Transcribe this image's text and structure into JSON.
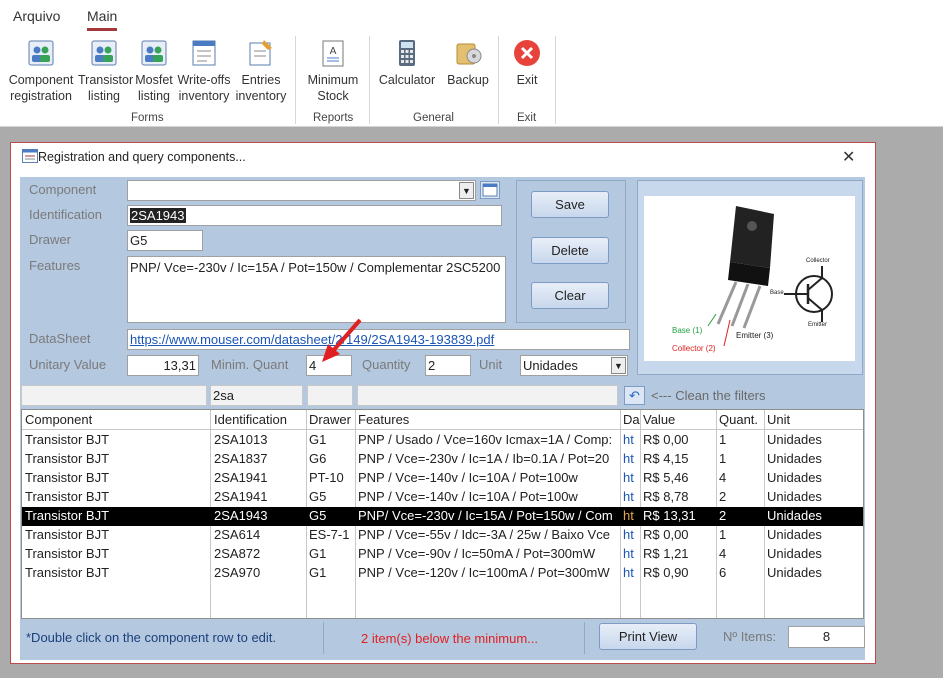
{
  "ribbon": {
    "tabs": [
      "Arquivo",
      "Main"
    ],
    "buttons": {
      "component_registration": "Component registration",
      "transistor_listing": "Transistor listing",
      "mosfet_listing": "Mosfet listing",
      "write_offs_inventory": "Write-offs inventory",
      "entries_inventory": "Entries inventory",
      "minimum_stock": "Minimum Stock",
      "calculator": "Calculator",
      "backup": "Backup",
      "exit": "Exit"
    },
    "groups": [
      "Forms",
      "Reports",
      "General",
      "Exit"
    ]
  },
  "dialog": {
    "title": "Registration and query components...",
    "close": "✕"
  },
  "form": {
    "labels": {
      "component": "Component",
      "identification": "Identification",
      "drawer": "Drawer",
      "features": "Features",
      "datasheet": "DataSheet",
      "unitary_value": "Unitary Value",
      "minim_quant": "Minim. Quant",
      "quantity": "Quantity",
      "unit": "Unit"
    },
    "values": {
      "component": "",
      "identification": "2SA1943",
      "drawer": "G5",
      "features": "PNP/ Vce=-230v / Ic=15A / Pot=150w / Complementar 2SC5200",
      "datasheet": "https://www.mouser.com/datasheet/2/149/2SA1943-193839.pdf",
      "unitary_value": "13,31",
      "minim_quant": "4",
      "quantity": "2",
      "unit": "Unidades"
    }
  },
  "actions": {
    "save": "Save",
    "delete": "Delete",
    "clear": "Clear"
  },
  "image_labels": {
    "base": "Base (1)",
    "collector": "Collector (2)",
    "emitter": "Emitter (3)",
    "sym_collector": "Collector",
    "sym_base": "Base",
    "sym_emitter": "Emitter"
  },
  "filters": {
    "identification": "2sa",
    "hint": "<--- Clean the filters"
  },
  "table": {
    "headers": [
      "Component",
      "Identification",
      "Drawer",
      "Features",
      "Da",
      "Value",
      "Quant.",
      "Unit"
    ],
    "rows": [
      [
        "Transistor BJT",
        "2SA1013",
        "G1",
        "PNP / Usado / Vce=160v Icmax=1A / Comp:",
        "ht",
        "R$ 0,00",
        "1",
        "Unidades"
      ],
      [
        "Transistor BJT",
        "2SA1837",
        "G6",
        "PNP / Vce=-230v / Ic=1A / Ib=0.1A / Pot=20",
        "ht",
        "R$ 4,15",
        "1",
        "Unidades"
      ],
      [
        "Transistor BJT",
        "2SA1941",
        "PT-10",
        "PNP / Vce=-140v / Ic=10A / Pot=100w",
        "ht",
        "R$ 5,46",
        "4",
        "Unidades"
      ],
      [
        "Transistor BJT",
        "2SA1941",
        "G5",
        "PNP / Vce=-140v / Ic=10A / Pot=100w",
        "ht",
        "R$ 8,78",
        "2",
        "Unidades"
      ],
      [
        "Transistor BJT",
        "2SA1943",
        "G5",
        "PNP/ Vce=-230v / Ic=15A / Pot=150w / Com",
        "ht",
        "R$ 13,31",
        "2",
        "Unidades"
      ],
      [
        "Transistor BJT",
        "2SA614",
        "ES-7-1",
        "PNP / Vce=-55v / Idc=-3A / 25w / Baixo Vce",
        "ht",
        "R$ 0,00",
        "1",
        "Unidades"
      ],
      [
        "Transistor BJT",
        "2SA872",
        "G1",
        "PNP / Vce=-90v / Ic=50mA / Pot=300mW",
        "ht",
        "R$ 1,21",
        "4",
        "Unidades"
      ],
      [
        "Transistor BJT",
        "2SA970",
        "G1",
        "PNP / Vce=-120v / Ic=100mA / Pot=300mW",
        "ht",
        "R$ 0,90",
        "6",
        "Unidades"
      ]
    ]
  },
  "footer": {
    "hint": "*Double click on the component row to edit.",
    "warning": "2 item(s) below the minimum...",
    "print": "Print View",
    "items_label": "Nº Items:",
    "items_count": "8"
  },
  "colors": {
    "accent": "#a4373a",
    "panel": "#b4c8e0",
    "warning": "#e02020",
    "link": "#1a55b5"
  }
}
